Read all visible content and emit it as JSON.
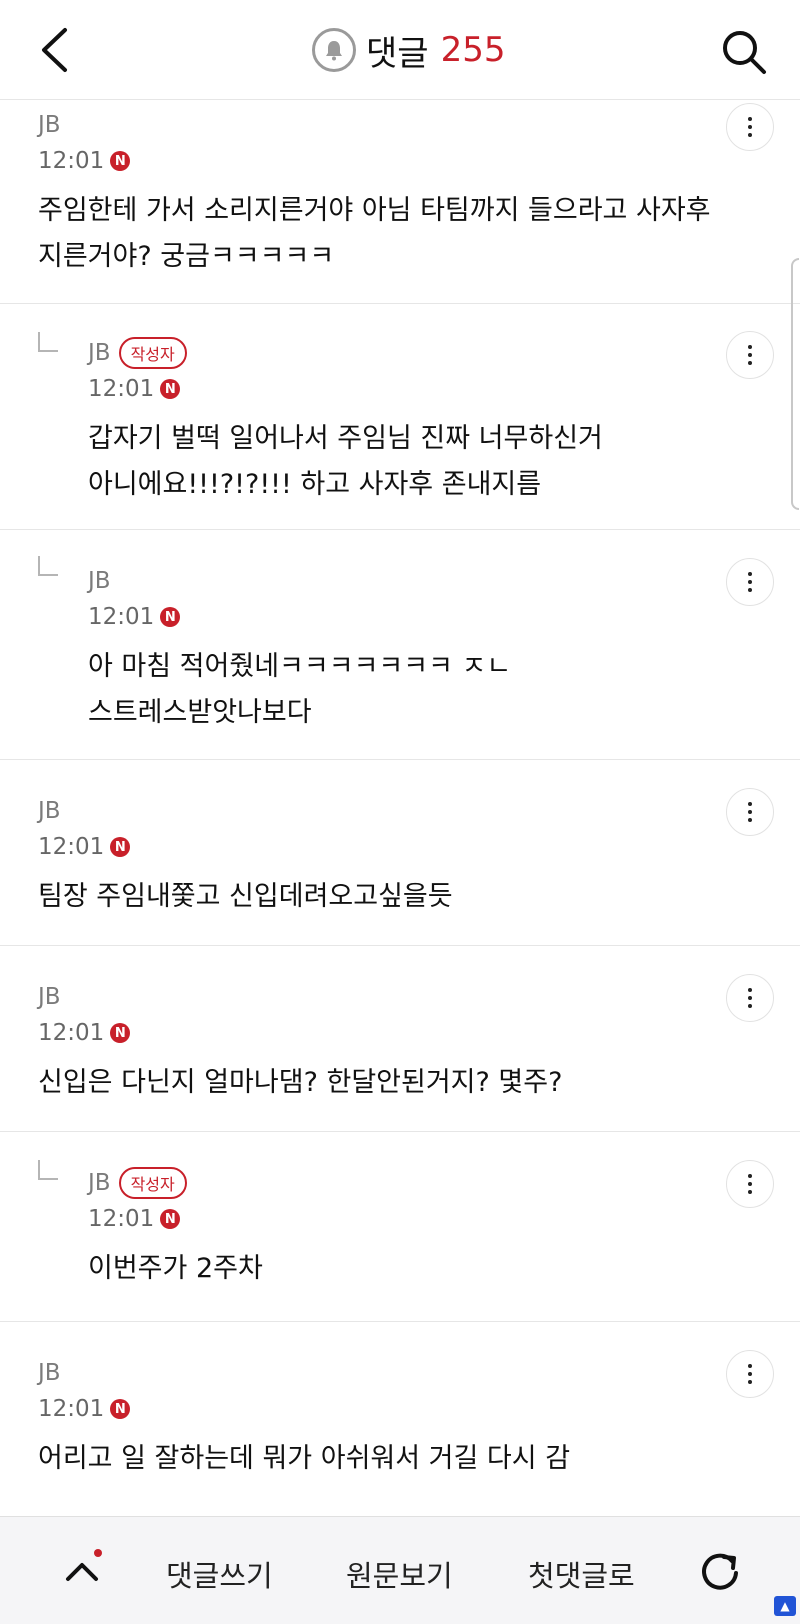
{
  "header": {
    "title": "댓글",
    "count": "255",
    "icons": {
      "back": "chevron-left-icon",
      "bell": "bell-icon",
      "search": "search-icon"
    }
  },
  "comments": [
    {
      "author": "JB",
      "time": "12:01",
      "new_badge": "N",
      "reply": false,
      "writer_badge": "",
      "text": "주임한테 가서 소리지른거야 아님 타팀까지 들으라고 사자후\n지른거야? 궁금ㅋㅋㅋㅋㅋ"
    },
    {
      "author": "JB",
      "time": "12:01",
      "new_badge": "N",
      "reply": true,
      "writer_badge": "작성자",
      "text": "갑자기 벌떡 일어나서 주임님 진짜 너무하신거\n아니에요!!!?!?!!! 하고 사자후 존내지름"
    },
    {
      "author": "JB",
      "time": "12:01",
      "new_badge": "N",
      "reply": true,
      "writer_badge": "",
      "text": "아 마침 적어줬네ㅋㅋㅋㅋㅋㅋㅋ ㅈㄴ\n스트레스받앗나보다"
    },
    {
      "author": "JB",
      "time": "12:01",
      "new_badge": "N",
      "reply": false,
      "writer_badge": "",
      "text": "팀장 주임내쫓고 신입데려오고싶을듯"
    },
    {
      "author": "JB",
      "time": "12:01",
      "new_badge": "N",
      "reply": false,
      "writer_badge": "",
      "text": "신입은 다닌지 얼마나댐? 한달안된거지? 몇주?"
    },
    {
      "author": "JB",
      "time": "12:01",
      "new_badge": "N",
      "reply": true,
      "writer_badge": "작성자",
      "text": "이번주가 2주차"
    },
    {
      "author": "JB",
      "time": "12:01",
      "new_badge": "N",
      "reply": false,
      "writer_badge": "",
      "text": "어리고 일 잘하는데 뭐가 아쉬워서 거길 다시 감"
    }
  ],
  "bottom_bar": {
    "write": "댓글쓰기",
    "original": "원문보기",
    "first": "첫댓글로"
  },
  "colors": {
    "accent": "#c8202a",
    "muted": "#7b7b7b"
  }
}
